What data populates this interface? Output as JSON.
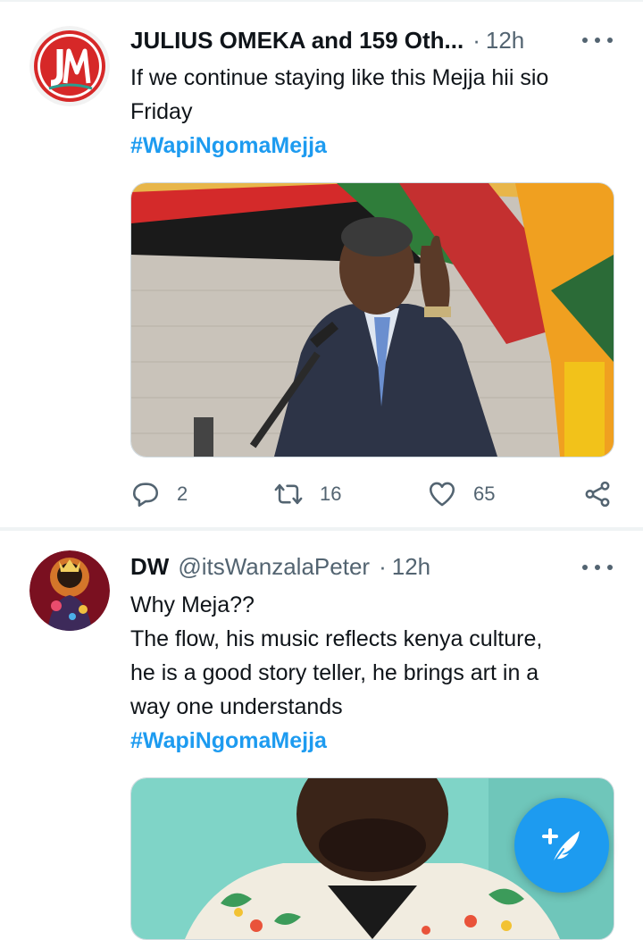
{
  "tweets": [
    {
      "author_name": "JULIUS OMEKA and 159 Oth...",
      "separator": "·",
      "time": "12h",
      "text_lines": [
        "If we continue staying like this Mejja hii sio",
        "Friday"
      ],
      "hashtag": "#WapiNgomaMejja",
      "avatar_logo": "JM",
      "media_icon": "photo-politician-at-microphone",
      "reply_count": "2",
      "retweet_count": "16",
      "like_count": "65"
    },
    {
      "author_name": "DW",
      "author_handle": "@itsWanzalaPeter",
      "separator": "·",
      "time": "12h",
      "text_lines": [
        "Why Meja??",
        "The flow, his music reflects kenya culture,",
        "he is a good story teller, he brings art in a",
        "way one understands"
      ],
      "hashtag": "#WapiNgomaMejja",
      "media_icon": "photo-man-in-floral-shirt"
    }
  ],
  "compose": {
    "icon": "feather-plus-icon"
  },
  "colors": {
    "accent": "#1d9bf0",
    "secondary_text": "#536471",
    "border": "#cfd9de"
  }
}
